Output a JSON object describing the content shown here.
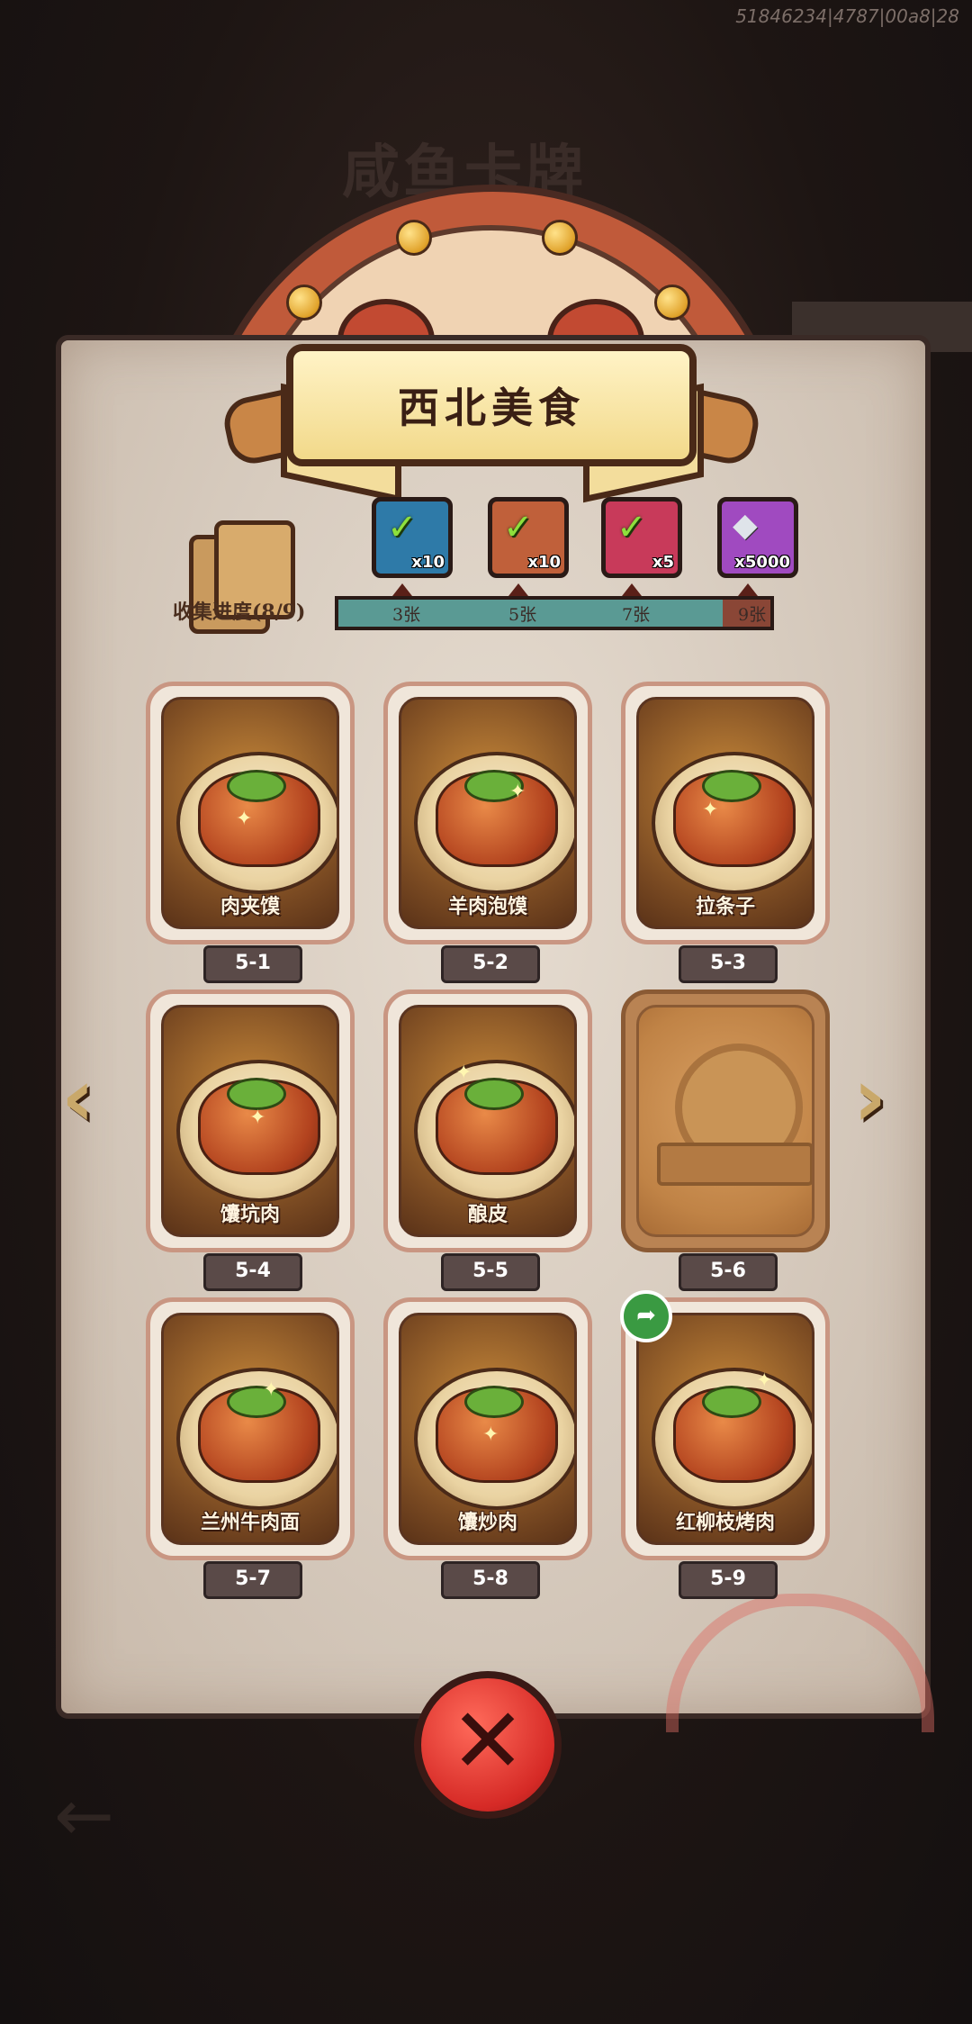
{
  "debug_id": "51846234|4787|00a8|28",
  "background_title": "咸鱼卡牌",
  "panel": {
    "title": "西北美食",
    "progress_label": "收集进度(8/9)"
  },
  "rewards": [
    {
      "icon": "green-chest-icon",
      "qty": "x10",
      "color": "#2e7aa8",
      "claimed": true
    },
    {
      "icon": "orange-key-icon",
      "qty": "x10",
      "color": "#c0603a",
      "claimed": true
    },
    {
      "icon": "purple-orb-icon",
      "qty": "x5",
      "color": "#c83a5a",
      "claimed": true
    },
    {
      "icon": "silver-crystal-icon",
      "qty": "x5000",
      "color": "#a04ac0",
      "claimed": false
    }
  ],
  "milestones": [
    "3张",
    "5张",
    "7张",
    "9张"
  ],
  "progress": {
    "collected": 8,
    "total": 9
  },
  "foods": [
    {
      "name": "肉夹馍",
      "code": "5-1",
      "locked": false
    },
    {
      "name": "羊肉泡馍",
      "code": "5-2",
      "locked": false
    },
    {
      "name": "拉条子",
      "code": "5-3",
      "locked": false
    },
    {
      "name": "馕坑肉",
      "code": "5-4",
      "locked": false
    },
    {
      "name": "酿皮",
      "code": "5-5",
      "locked": false
    },
    {
      "name": "",
      "code": "5-6",
      "locked": true
    },
    {
      "name": "兰州牛肉面",
      "code": "5-7",
      "locked": false
    },
    {
      "name": "馕炒肉",
      "code": "5-8",
      "locked": false
    },
    {
      "name": "红柳枝烤肉",
      "code": "5-9",
      "locked": false
    }
  ],
  "icons": {
    "prev": "chevron-left-icon",
    "next": "chevron-right-icon",
    "close": "close-icon",
    "share": "share-icon"
  }
}
